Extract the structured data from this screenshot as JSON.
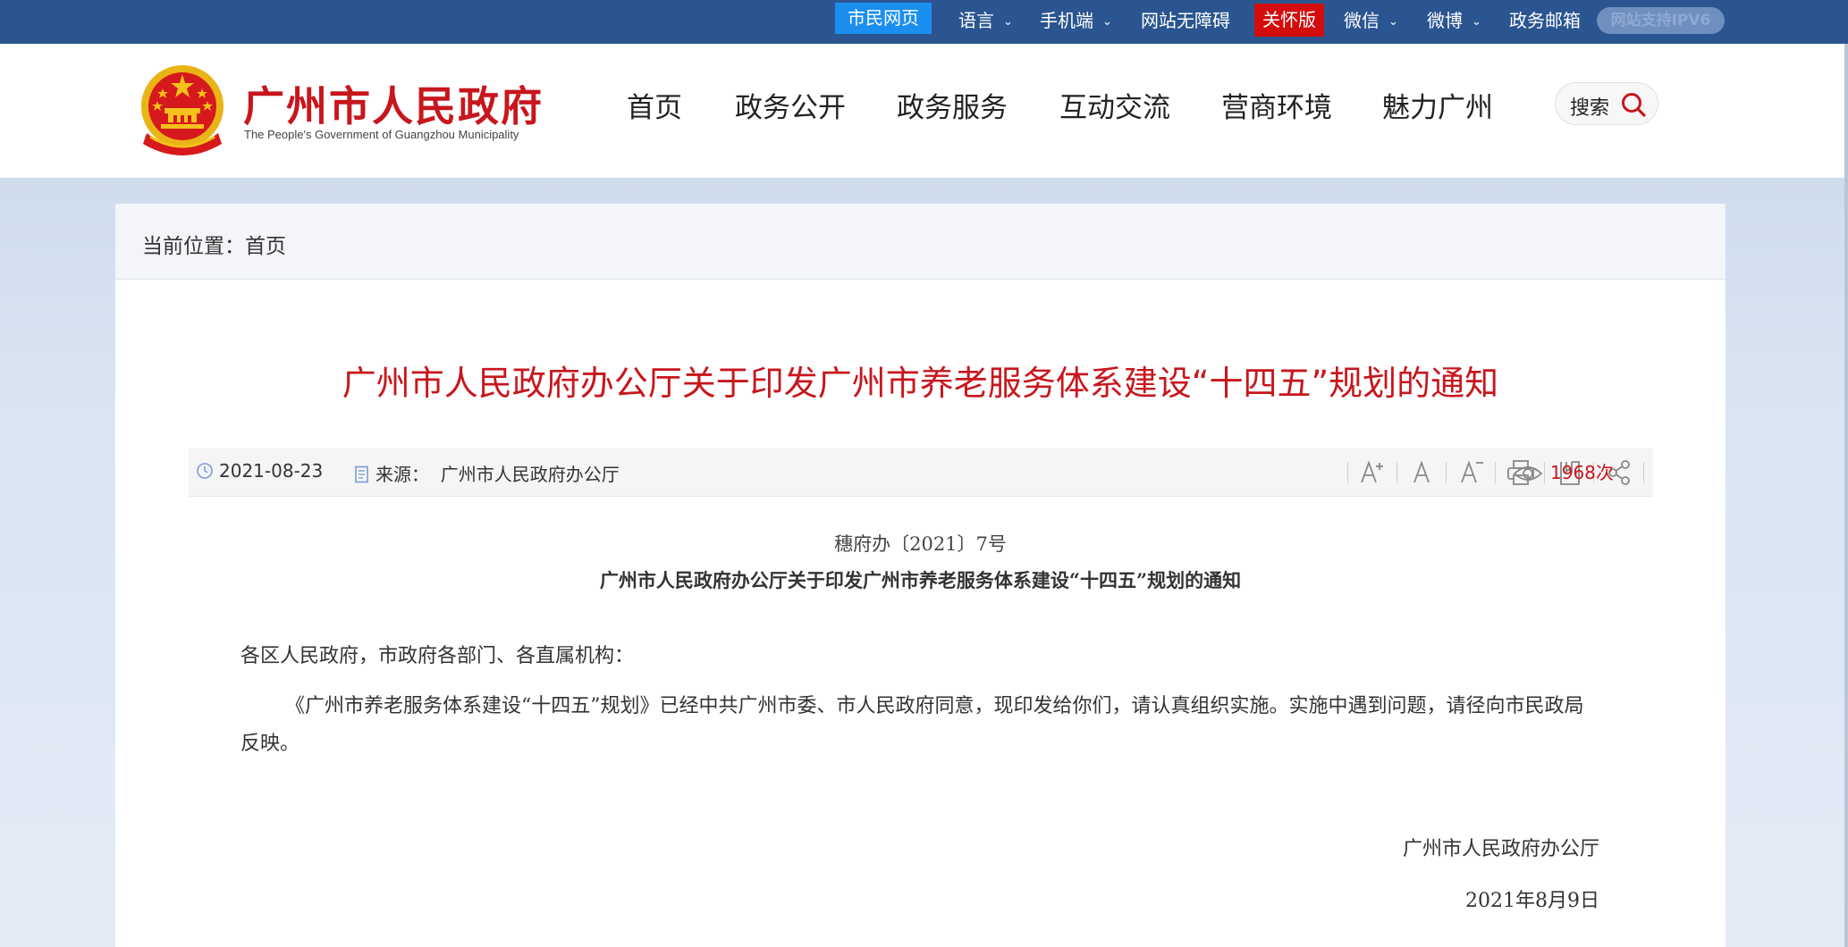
{
  "topbar": {
    "citizen_label": "市民网页",
    "language_label": "语言",
    "mobile_label": "手机端",
    "accessibility_label": "网站无障碍",
    "care_label": "关怀版",
    "wechat_label": "微信",
    "weibo_label": "微博",
    "email_label": "政务邮箱",
    "ipv6_label": "网站支持IPV6"
  },
  "header": {
    "title": "广州市人民政府",
    "subtitle": "The People's Government of Guangzhou Municipality",
    "nav": [
      "首页",
      "政务公开",
      "政务服务",
      "互动交流",
      "营商环境",
      "魅力广州"
    ],
    "search_label": "搜索"
  },
  "breadcrumb": {
    "label": "当前位置：首页"
  },
  "article": {
    "title": "广州市人民政府办公厅关于印发广州市养老服务体系建设“十四五”规划的通知",
    "date": "2021-08-23",
    "source_label": "来源：",
    "source": "广州市人民政府办公厅",
    "views": "1968",
    "views_unit": "次",
    "doc_number": "穗府办〔2021〕7号",
    "doc_title": "广州市人民政府办公厅关于印发广州市养老服务体系建设“十四五”规划的通知",
    "salutation": "各区人民政府，市政府各部门、各直属机构：",
    "paragraph": "《广州市养老服务体系建设“十四五”规划》已经中共广州市委、市人民政府同意，现印发给你们，请认真组织实施。实施中遇到问题，请径向市民政局反映。",
    "signature_org": "广州市人民政府办公厅",
    "signature_date": "2021年8月9日"
  },
  "colors": {
    "topbar_bg": "#2b5590",
    "brand_red": "#c8161d",
    "citizen_blue": "#1b8ff0",
    "care_red": "#d30c0c"
  },
  "icons": {
    "emblem": "national-emblem-icon",
    "search": "search-icon",
    "clock": "clock-icon",
    "document": "document-icon",
    "font_increase": "font-increase-icon",
    "font_reset": "font-reset-icon",
    "font_decrease": "font-decrease-icon",
    "print": "print-icon",
    "bookmark": "bookmark-icon",
    "share": "share-icon",
    "eye": "eye-icon"
  }
}
